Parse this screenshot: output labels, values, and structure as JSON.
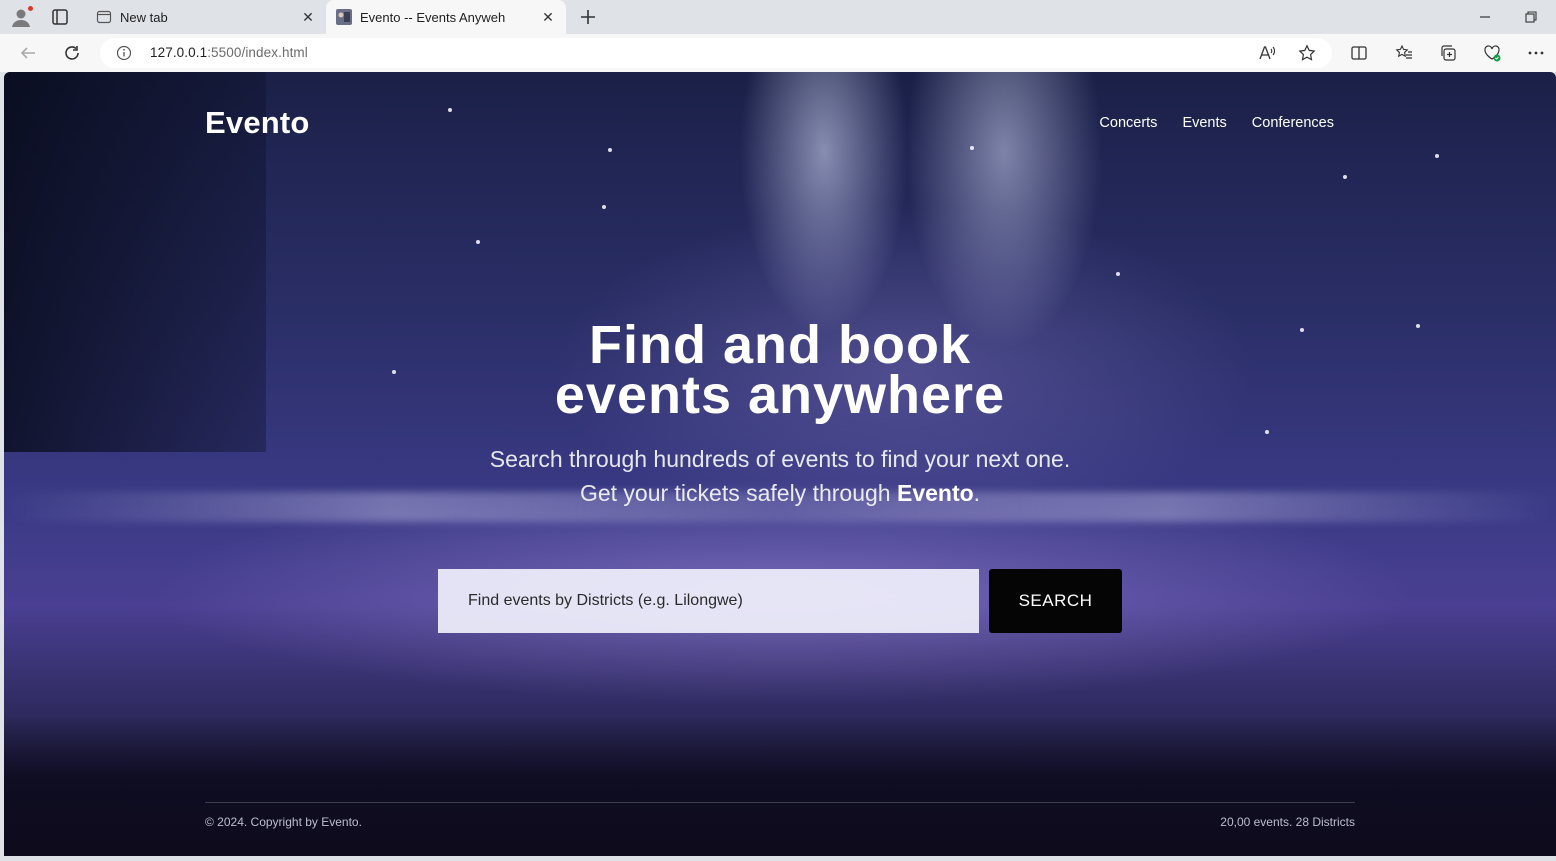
{
  "browser": {
    "tabs": [
      {
        "title": "New tab",
        "active": false
      },
      {
        "title": "Evento -- Events Anyweh",
        "active": true
      }
    ],
    "url_host": "127.0.0.1",
    "url_rest": ":5500/index.html"
  },
  "site": {
    "brand": "Evento",
    "nav": [
      "Concerts",
      "Events",
      "Conferences"
    ],
    "hero_line1": "Find and book",
    "hero_line2": "events anywhere",
    "sub_line1": "Search through hundreds of events to find your next one.",
    "sub_line2_prefix": "Get your tickets safely through ",
    "sub_line2_brand": "Evento",
    "sub_line2_suffix": ".",
    "search_placeholder": "Find events by Districts (e.g. Lilongwe)",
    "search_button": "SEARCH",
    "footer_copyright": "© 2024. Copyright by Evento.",
    "footer_stats": "20,00 events. 28 Districts"
  },
  "colors": {
    "accent": "#050505",
    "hero_bg_top": "#1b2048",
    "hero_bg_mid": "#3a3a86"
  }
}
